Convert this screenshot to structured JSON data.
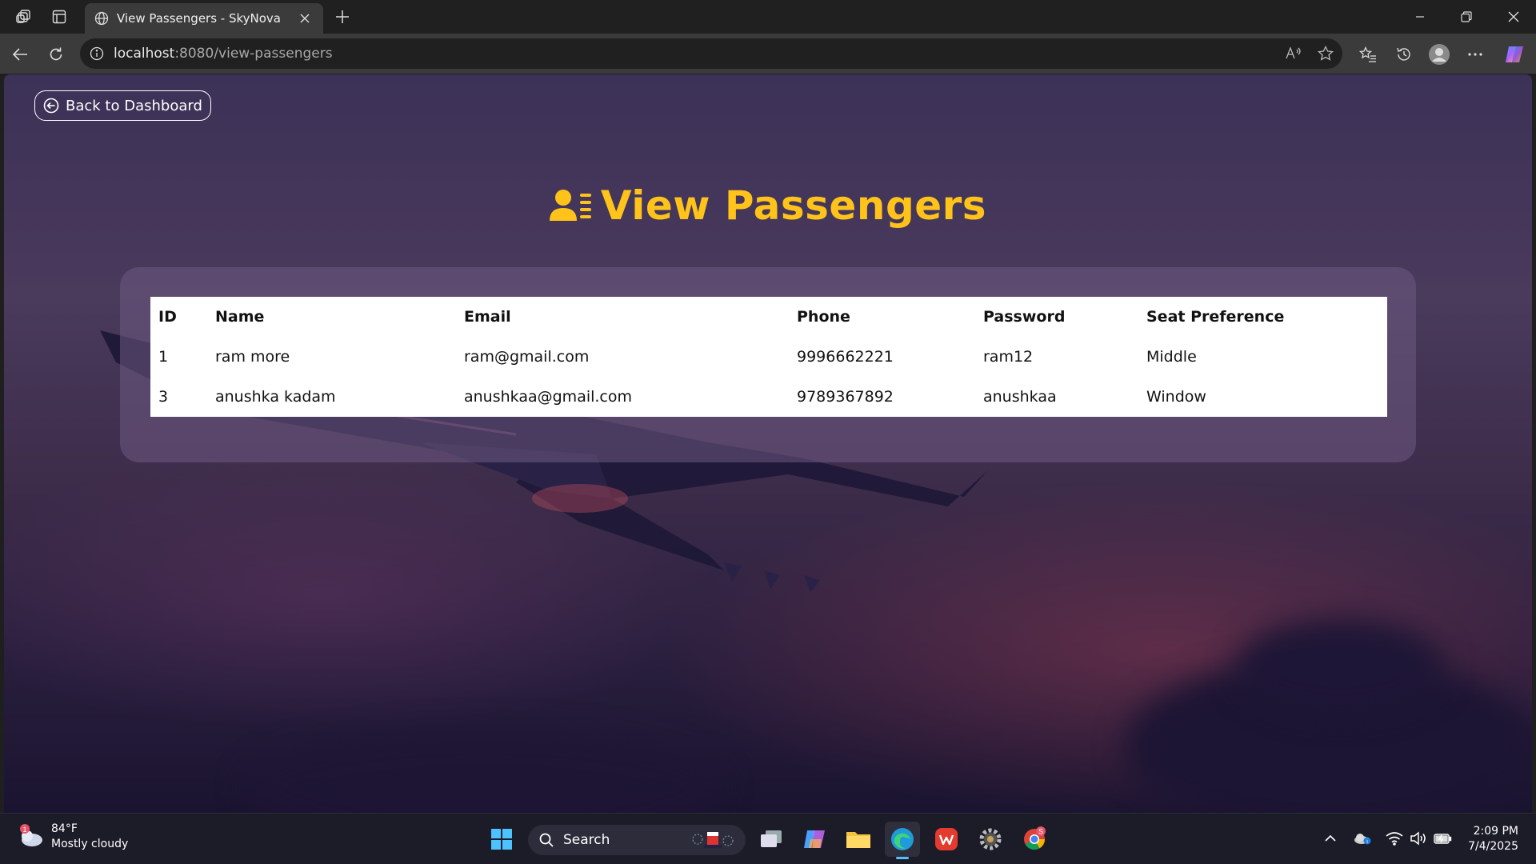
{
  "browser": {
    "tab_title": "View Passengers - SkyNova",
    "url_host": "localhost",
    "url_path": ":8080/view-passengers"
  },
  "page": {
    "back_label": "Back to Dashboard",
    "title": "View Passengers",
    "accent": "#ffc31a",
    "table": {
      "headers": [
        "ID",
        "Name",
        "Email",
        "Phone",
        "Password",
        "Seat Preference"
      ],
      "rows": [
        [
          "1",
          "ram more",
          "ram@gmail.com",
          "9996662221",
          "ram12",
          "Middle"
        ],
        [
          "3",
          "anushka kadam",
          "anushkaa@gmail.com",
          "9789367892",
          "anushkaa",
          "Window"
        ]
      ]
    }
  },
  "taskbar": {
    "weather_temp": "84°F",
    "weather_desc": "Mostly cloudy",
    "weather_badge": "1",
    "search_label": "Search",
    "time": "2:09 PM",
    "date": "7/4/2025",
    "chrome_badge": "S"
  }
}
